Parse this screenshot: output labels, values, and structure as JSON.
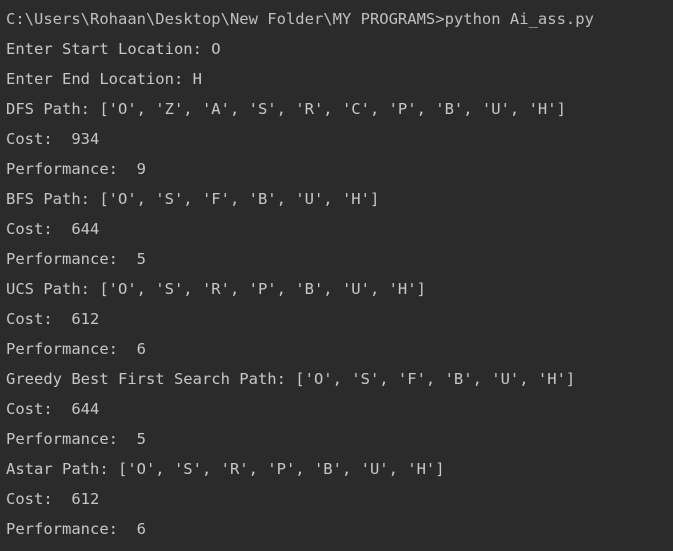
{
  "terminal": {
    "lines": [
      "C:\\Users\\Rohaan\\Desktop\\New Folder\\MY PROGRAMS>python Ai_ass.py",
      "Enter Start Location: O",
      "Enter End Location: H",
      "DFS Path: ['O', 'Z', 'A', 'S', 'R', 'C', 'P', 'B', 'U', 'H']",
      "Cost:  934",
      "Performance:  9",
      "BFS Path: ['O', 'S', 'F', 'B', 'U', 'H']",
      "Cost:  644",
      "Performance:  5",
      "UCS Path: ['O', 'S', 'R', 'P', 'B', 'U', 'H']",
      "Cost:  612",
      "Performance:  6",
      "Greedy Best First Search Path: ['O', 'S', 'F', 'B', 'U', 'H']",
      "Cost:  644",
      "Performance:  5",
      "Astar Path: ['O', 'S', 'R', 'P', 'B', 'U', 'H']",
      "Cost:  612",
      "Performance:  6"
    ]
  },
  "colors": {
    "background": "#2b2b2b",
    "text": "#c7c7c7"
  }
}
